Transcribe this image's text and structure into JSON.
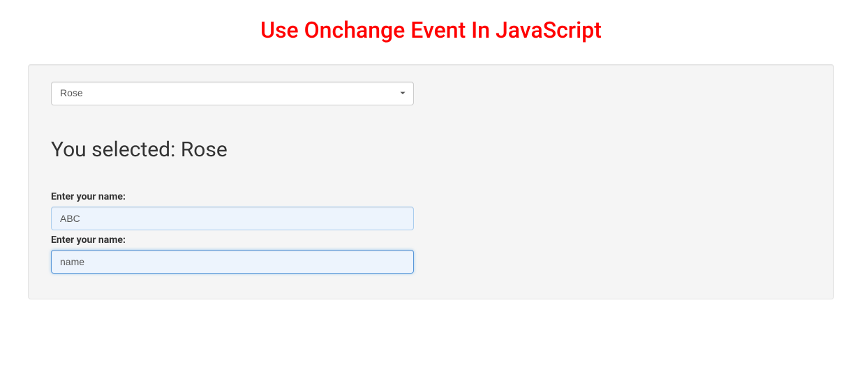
{
  "title": "Use Onchange Event In JavaScript",
  "dropdown": {
    "selected": "Rose"
  },
  "result": {
    "prefix": "You selected: ",
    "value": "Rose"
  },
  "form": {
    "field1": {
      "label": "Enter your name:",
      "value": "ABC"
    },
    "field2": {
      "label": "Enter your name:",
      "value": "name"
    }
  }
}
